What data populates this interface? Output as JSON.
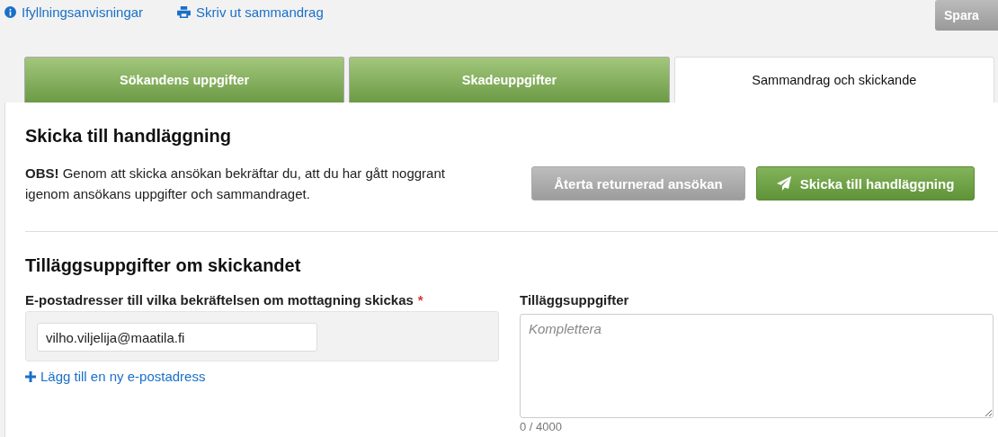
{
  "toolbar": {
    "links": [
      {
        "kind": "info",
        "label": "Ifyllningsanvisningar"
      },
      {
        "kind": "print",
        "label": "Skriv ut sammandrag"
      }
    ],
    "save_button": {
      "label": "Spara",
      "disabled": true
    }
  },
  "tabs": [
    {
      "label": "Sökandens uppgifter",
      "selected": false
    },
    {
      "label": "Skadeuppgifter",
      "selected": false
    },
    {
      "label": "Sammandrag och skickande",
      "selected": true
    }
  ],
  "send_section": {
    "title": "Skicka till handläggning",
    "notice": "**OBS!** Genom att skicka ansökan bekräftar du, att du har gått noggrant igenom ansökans uppgifter och sammandraget.",
    "buttons": [
      {
        "label": "Återta returnerad ansökan",
        "kind": "plain",
        "disabled": true
      },
      {
        "label": "Skicka till handläggning",
        "kind": "send",
        "disabled": false
      }
    ]
  },
  "extra_section": {
    "title": "Tilläggsuppgifter om skickandet",
    "email": {
      "label": "E-postadresser till vilka bekräftelsen om mottagning skickas",
      "required_mark": "*",
      "values": [
        "vilho.viljelija@maatila.fi"
      ],
      "add_link": "Lägg till en ny e-postadress"
    },
    "notes": {
      "label": "Tilläggsuppgifter",
      "placeholder": "Komplettera",
      "counter": "0 / 4000"
    }
  }
}
